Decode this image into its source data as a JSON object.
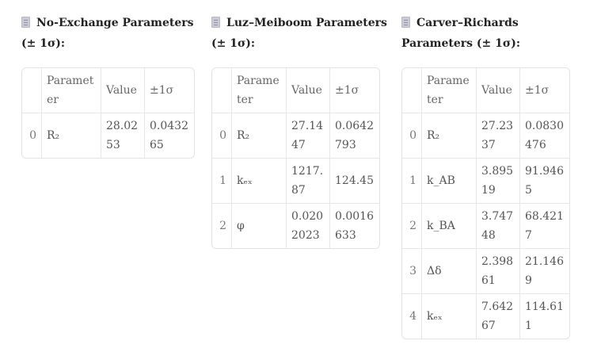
{
  "tables": [
    {
      "title": "No-Exchange Parameters (± 1σ):",
      "headers": [
        "",
        "Parameter",
        "Value",
        "±1σ"
      ],
      "rows": [
        [
          "0",
          "R₂",
          "28.0253",
          "0.043265"
        ]
      ]
    },
    {
      "title": "Luz–Meiboom Parameters (± 1σ):",
      "headers": [
        "",
        "Parameter",
        "Value",
        "±1σ"
      ],
      "rows": [
        [
          "0",
          "R₂",
          "27.1447",
          "0.0642793"
        ],
        [
          "1",
          "kₑₓ",
          "1217.87",
          "124.45"
        ],
        [
          "2",
          "φ",
          "0.0202023",
          "0.0016633"
        ]
      ]
    },
    {
      "title": "Carver–Richards Parameters (± 1σ):",
      "headers": [
        "",
        "Parameter",
        "Value",
        "±1σ"
      ],
      "rows": [
        [
          "0",
          "R₂",
          "27.2337",
          "0.0830476"
        ],
        [
          "1",
          "k_AB",
          "3.89519",
          "91.9465"
        ],
        [
          "2",
          "k_BA",
          "3.74748",
          "68.4217"
        ],
        [
          "3",
          "Δδ",
          "2.39861",
          "21.1469"
        ],
        [
          "4",
          "kₑₓ",
          "7.64267",
          "114.611"
        ]
      ]
    }
  ]
}
